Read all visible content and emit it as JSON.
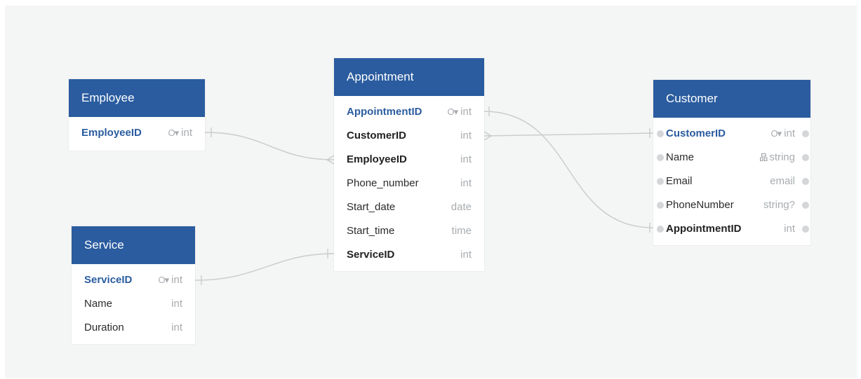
{
  "tables": {
    "employee": {
      "title": "Employee",
      "rows": [
        {
          "name": "EmployeeID",
          "type": "int"
        }
      ]
    },
    "service": {
      "title": "Service",
      "rows": [
        {
          "name": "ServiceID",
          "type": "int"
        },
        {
          "name": "Name",
          "type": "int"
        },
        {
          "name": "Duration",
          "type": "int"
        }
      ]
    },
    "appointment": {
      "title": "Appointment",
      "rows": [
        {
          "name": "AppointmentID",
          "type": "int"
        },
        {
          "name": "CustomerID",
          "type": "int"
        },
        {
          "name": "EmployeeID",
          "type": "int"
        },
        {
          "name": "Phone_number",
          "type": "int"
        },
        {
          "name": "Start_date",
          "type": "date"
        },
        {
          "name": "Start_time",
          "type": "time"
        },
        {
          "name": "ServiceID",
          "type": "int"
        }
      ]
    },
    "customer": {
      "title": "Customer",
      "rows": [
        {
          "name": "CustomerID",
          "type": "int"
        },
        {
          "name": "Name",
          "type": "string"
        },
        {
          "name": "Email",
          "type": "email"
        },
        {
          "name": "PhoneNumber",
          "type": "string?"
        },
        {
          "name": "AppointmentID",
          "type": "int"
        }
      ]
    }
  },
  "icons": {
    "primary_key": "key-icon",
    "indexed": "index-tree-icon",
    "column_handle": "handle-dot-icon"
  },
  "colors": {
    "header": "#2a5c9f",
    "primary_key_text": "#2a5c9f",
    "type_text": "#a8acb0",
    "canvas": "#f4f5f5",
    "relation_line": "#c9cbcd"
  }
}
